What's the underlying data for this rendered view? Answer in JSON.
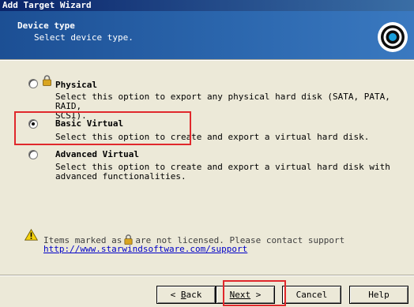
{
  "window": {
    "title": "Add Target Wizard"
  },
  "header": {
    "title": "Device type",
    "subtitle": "Select device type."
  },
  "options": [
    {
      "title": "Physical",
      "description": "Select this option to export any physical hard disk (SATA, PATA, RAID,\nSCSI).",
      "checked": false,
      "locked": true
    },
    {
      "title": "Basic Virtual",
      "description": "Select this option to create and export a virtual hard disk.",
      "checked": true,
      "locked": false
    },
    {
      "title": "Advanced Virtual",
      "description": "Select this option to create and export a virtual hard disk with\nadvanced functionalities.",
      "checked": false,
      "locked": false
    }
  ],
  "license_note": {
    "before": "Items marked as",
    "after": "are not licensed. Please contact support",
    "link": "http://www.starwindsoftware.com/support"
  },
  "buttons": {
    "back": {
      "prefix": "< ",
      "hotkey": "B",
      "rest": "ack"
    },
    "next": {
      "hotkey": "N",
      "rest": "ext",
      "suffix": " >"
    },
    "cancel": "Cancel",
    "help": "Help"
  },
  "colors": {
    "header_bg": "#2b66ad",
    "highlight": "#e0282c",
    "link": "#0000c8"
  }
}
